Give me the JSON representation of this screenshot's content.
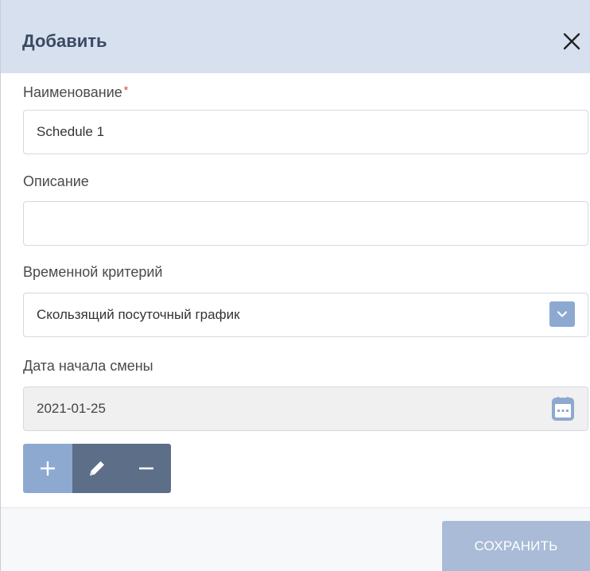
{
  "dialog": {
    "title": "Добавить",
    "close_icon": "close-icon"
  },
  "fields": {
    "name": {
      "label": "Наименование",
      "required_mark": "*",
      "value": "Schedule 1"
    },
    "description": {
      "label": "Описание",
      "value": ""
    },
    "time_criterion": {
      "label": "Временной критерий",
      "selected": "Скользящий посуточный график",
      "arrow_icon": "chevron-down-icon"
    },
    "shift_start_date": {
      "label": "Дата начала смены",
      "value": "2021-01-25",
      "calendar_icon": "calendar-icon"
    }
  },
  "toolbar": {
    "add_icon": "plus-icon",
    "edit_icon": "pencil-icon",
    "remove_icon": "minus-icon"
  },
  "footer": {
    "save_label": "СОХРАНИТЬ"
  },
  "colors": {
    "header_bg": "#d6e0ee",
    "accent": "#8ea9d0",
    "dark_button": "#5c6e88",
    "save_button": "#a9bbd6",
    "required": "#e53935"
  }
}
